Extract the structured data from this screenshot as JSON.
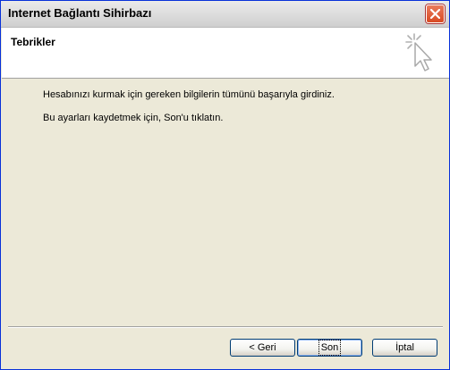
{
  "window": {
    "title": "Internet Bağlantı Sihirbazı",
    "close_icon": "close-icon"
  },
  "header": {
    "title": "Tebrikler",
    "icon": "wizard-cursor-sparkle-icon"
  },
  "content": {
    "paragraph1": "Hesabınızı kurmak için gereken bilgilerin tümünü başarıyla girdiniz.",
    "paragraph2": "Bu ayarları kaydetmek için, Son'u tıklatın."
  },
  "buttons": {
    "back": "< Geri",
    "finish": "Son",
    "cancel": "İptal"
  },
  "colors": {
    "titlebar": "#dcdcdc",
    "close": "#d84a22",
    "dialog_bg": "#ece9d8"
  }
}
